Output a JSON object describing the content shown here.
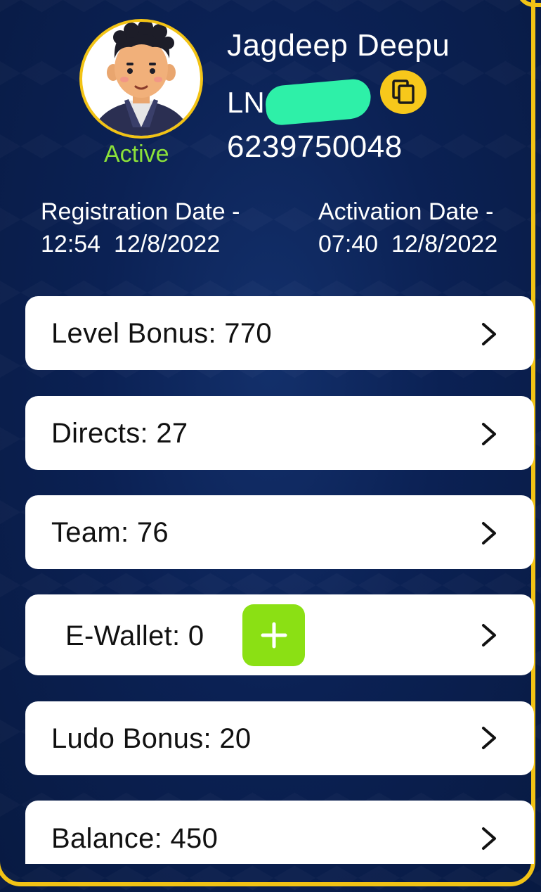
{
  "profile": {
    "name": "Jagdeep Deepu",
    "user_id_visible": "LN",
    "phone": "6239750048",
    "status": "Active"
  },
  "dates": {
    "registration_label": "Registration Date -",
    "registration_value": "12:54  12/8/2022",
    "activation_label": "Activation Date -",
    "activation_value": "07:40  12/8/2022"
  },
  "cards": [
    {
      "label": "Level Bonus: 770"
    },
    {
      "label": "Directs: 27"
    },
    {
      "label": "Team: 76"
    },
    {
      "label": "E-Wallet: 0"
    },
    {
      "label": "Ludo Bonus: 20"
    },
    {
      "label": "Balance: 450"
    }
  ],
  "colors": {
    "background": "#0b2154",
    "accent_border": "#f2c315",
    "active_status": "#8be13a",
    "add_button": "#8be014",
    "copy_button": "#f7c81b",
    "redaction": "#2ef0a8"
  },
  "icons": {
    "copy": "copy-icon",
    "add": "plus-icon",
    "chevron": "chevron-right-icon"
  }
}
